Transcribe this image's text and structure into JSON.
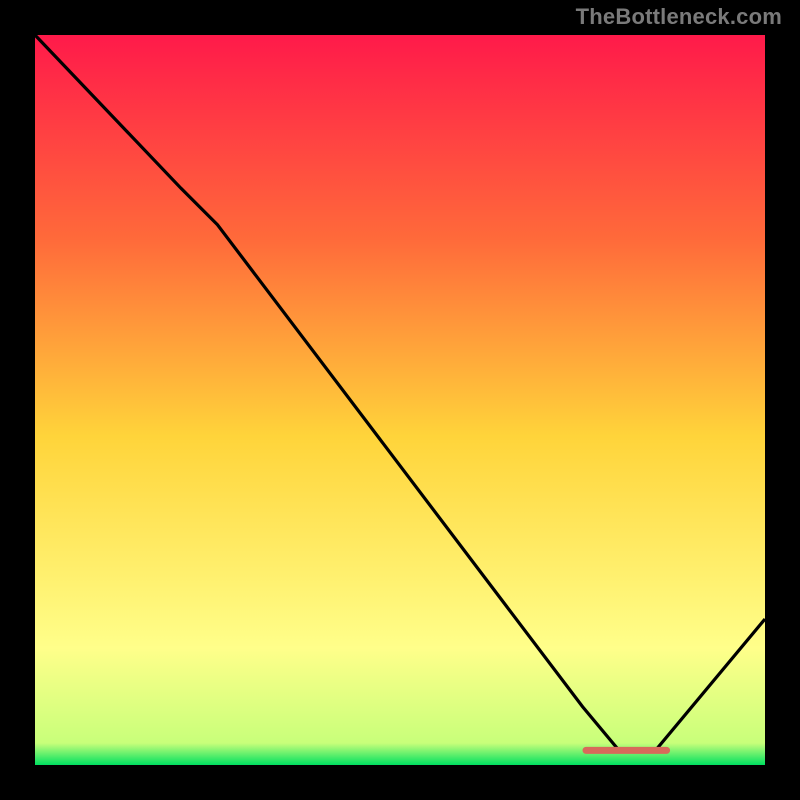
{
  "attribution": "TheBottleneck.com",
  "colors": {
    "gradient_top": "#ff1a4a",
    "gradient_mid_upper": "#ff6a3a",
    "gradient_mid": "#ffd43a",
    "gradient_lower": "#ffff8a",
    "gradient_bottom": "#00e060",
    "line": "#000000",
    "marker": "#d86a5a",
    "background": "#000000"
  },
  "chart_data": {
    "type": "line",
    "title": "",
    "xlabel": "",
    "ylabel": "",
    "xlim": [
      0,
      100
    ],
    "ylim": [
      0,
      100
    ],
    "series": [
      {
        "name": "curve",
        "x": [
          0,
          20,
          25,
          75,
          80,
          85,
          100
        ],
        "y": [
          100,
          79,
          74,
          8,
          2,
          2,
          20
        ]
      }
    ],
    "marker_segment": {
      "x_start": 75,
      "x_end": 87,
      "y": 2
    }
  }
}
